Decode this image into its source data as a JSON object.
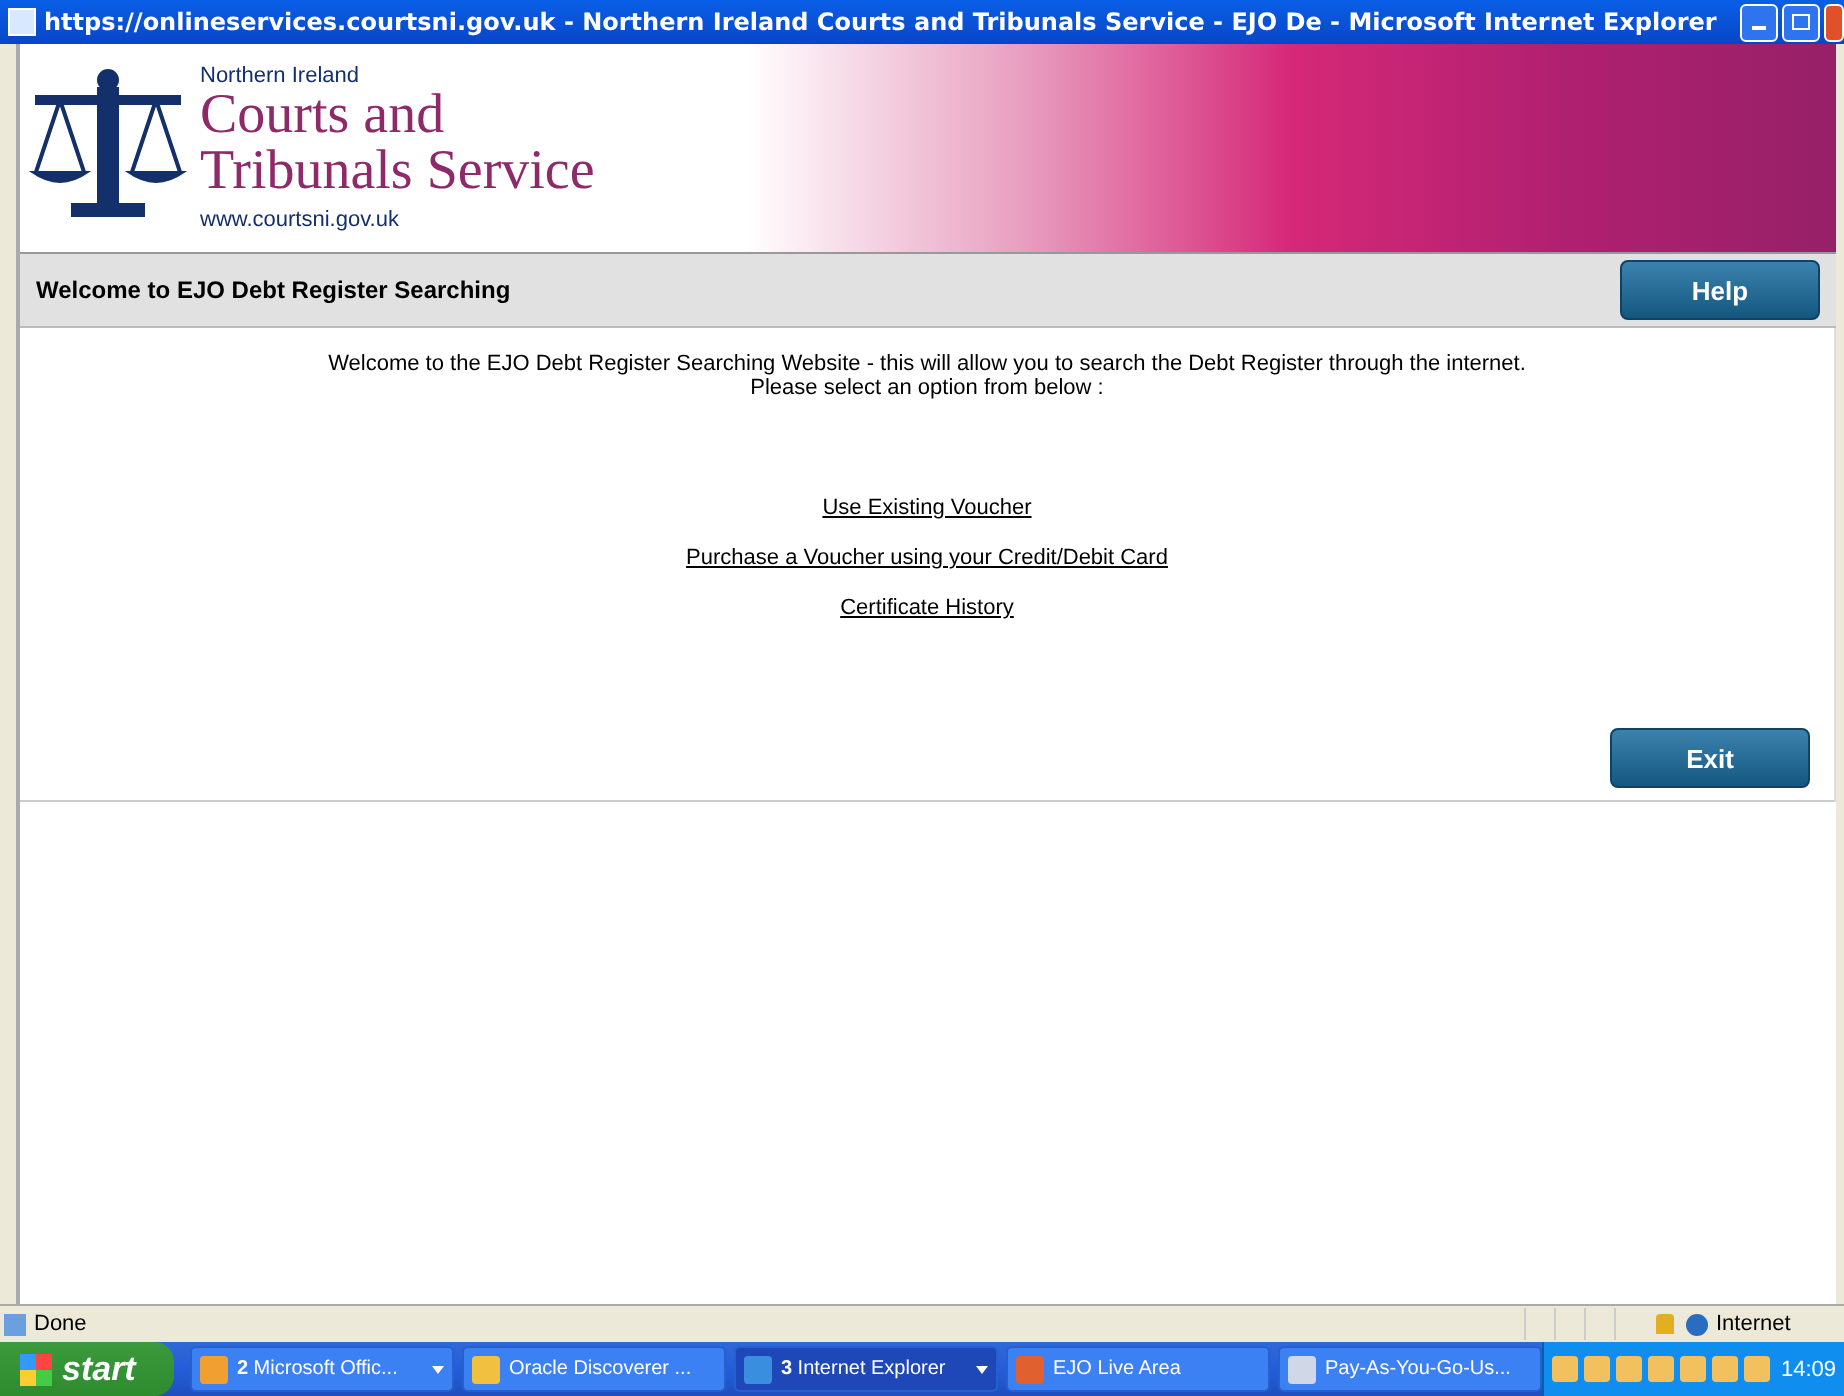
{
  "window": {
    "title": "https://onlineservices.courtsni.gov.uk - Northern Ireland Courts and Tribunals Service - EJO De - Microsoft Internet Explorer"
  },
  "banner": {
    "region": "Northern Ireland",
    "name_lines": [
      "Courts and",
      "Tribunals Service"
    ],
    "url": "www.courtsni.gov.uk"
  },
  "header": {
    "title": "Welcome to EJO Debt Register Searching",
    "help_button": "Help"
  },
  "intro": [
    "Welcome to the EJO Debt Register Searching Website - this will allow you to search the Debt Register through the internet.",
    "Please select an option from below :"
  ],
  "links": [
    "Use Existing Voucher",
    "Purchase a Voucher using your Credit/Debit Card",
    "Certificate History"
  ],
  "exit_button": "Exit",
  "status_bar": {
    "text": "Done",
    "zone": "Internet"
  },
  "taskbar": {
    "start": "start",
    "clock": "14:09",
    "tasks": [
      {
        "label": "**2** Microsoft Offic...",
        "selected": false,
        "grouped": true,
        "color": "#f0a030"
      },
      {
        "label": "Oracle Discoverer ...",
        "selected": false,
        "grouped": false,
        "color": "#f0c040"
      },
      {
        "label": "**3** Internet Explorer",
        "selected": true,
        "grouped": true,
        "color": "#3a8ee0"
      },
      {
        "label": "EJO Live Area",
        "selected": false,
        "grouped": false,
        "color": "#e06030"
      },
      {
        "label": "Pay-As-You-Go-Us...",
        "selected": false,
        "grouped": false,
        "color": "#d0d8e8"
      }
    ]
  }
}
